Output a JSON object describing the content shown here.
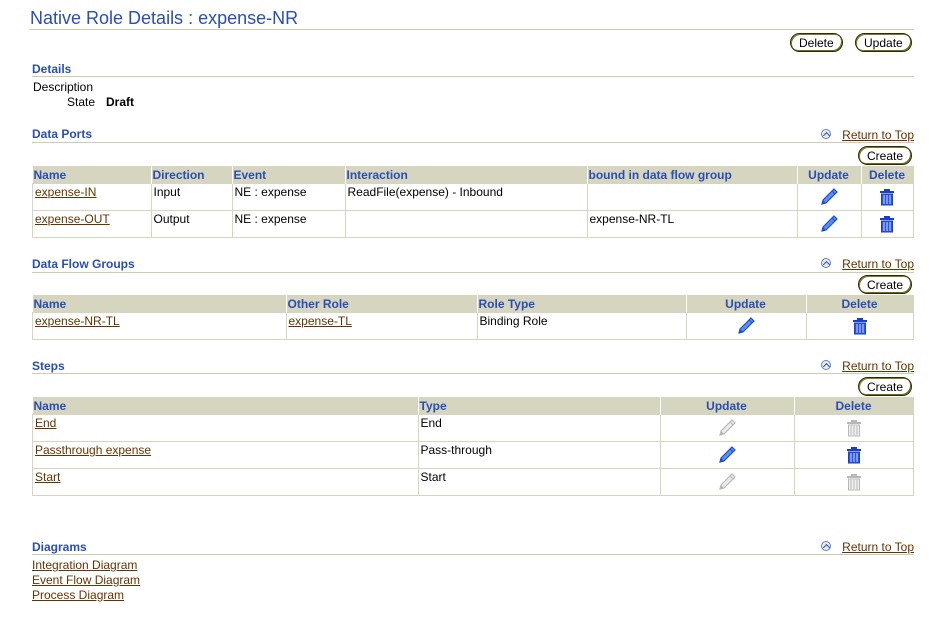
{
  "page": {
    "title": "Native Role Details : expense-NR",
    "buttons": {
      "delete": "Delete",
      "update": "Update"
    }
  },
  "details": {
    "heading": "Details",
    "description_label": "Description",
    "description_value": "",
    "state_label": "State",
    "state_value": "Draft"
  },
  "common": {
    "return_to_top": "Return to Top",
    "create": "Create",
    "colors": {
      "heading": "#2a4eb3",
      "link": "#663300",
      "header_bg": "#d6d6c0",
      "icon_active": "#1f4fd1",
      "icon_disabled": "#b8b8b8"
    }
  },
  "data_ports": {
    "heading": "Data Ports",
    "columns": [
      "Name",
      "Direction",
      "Event",
      "Interaction",
      "bound in data flow group",
      "Update",
      "Delete"
    ],
    "rows": [
      {
        "name": "expense-IN",
        "direction": "Input",
        "event": "NE : expense",
        "interaction": "ReadFile(expense) - Inbound",
        "bound": "",
        "update_enabled": true,
        "delete_enabled": true
      },
      {
        "name": "expense-OUT",
        "direction": "Output",
        "event": "NE : expense",
        "interaction": "",
        "bound": "expense-NR-TL",
        "update_enabled": true,
        "delete_enabled": true
      }
    ]
  },
  "data_flow_groups": {
    "heading": "Data Flow Groups",
    "columns": [
      "Name",
      "Other Role",
      "Role Type",
      "Update",
      "Delete"
    ],
    "rows": [
      {
        "name": "expense-NR-TL",
        "other_role": "expense-TL",
        "role_type": "Binding Role",
        "update_enabled": true,
        "delete_enabled": true
      }
    ]
  },
  "steps": {
    "heading": "Steps",
    "columns": [
      "Name",
      "Type",
      "Update",
      "Delete"
    ],
    "rows": [
      {
        "name": "End",
        "type": "End",
        "update_enabled": false,
        "delete_enabled": false
      },
      {
        "name": "Passthrough expense",
        "type": "Pass-through",
        "update_enabled": true,
        "delete_enabled": true
      },
      {
        "name": "Start",
        "type": "Start",
        "update_enabled": false,
        "delete_enabled": false
      }
    ]
  },
  "diagrams": {
    "heading": "Diagrams",
    "links": [
      "Integration Diagram",
      "Event Flow Diagram",
      "Process Diagram"
    ]
  }
}
